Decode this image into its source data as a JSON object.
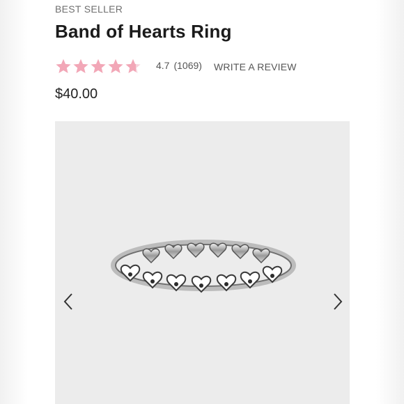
{
  "product": {
    "badge": "BEST SELLER",
    "title": "Band of Hearts Ring",
    "price": "$40.00"
  },
  "rating": {
    "value": "4.7",
    "count": "(1069)",
    "stars": 4.7,
    "star_color": "#f2a7b7",
    "write_review": "WRITE A REVIEW"
  },
  "gallery": {
    "image": "band-of-hearts-ring-image",
    "prev_icon": "chevron-left-icon",
    "next_icon": "chevron-right-icon"
  }
}
